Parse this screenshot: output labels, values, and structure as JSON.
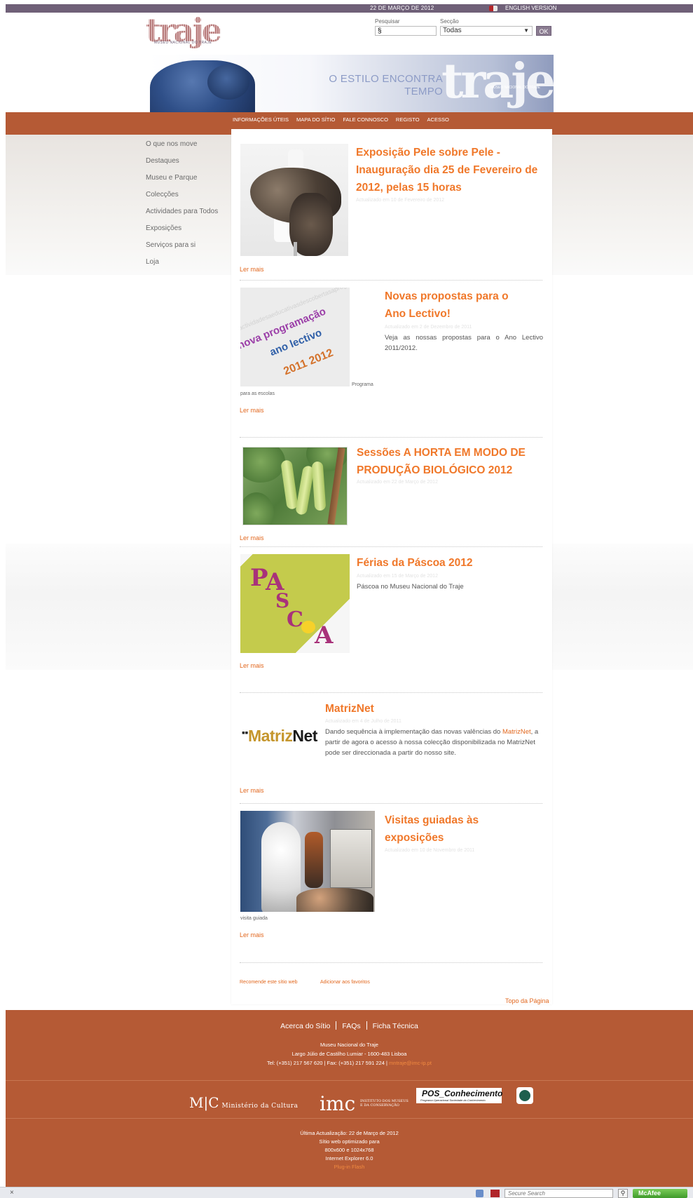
{
  "header": {
    "date": "22 DE MARÇO DE 2012",
    "english_link": "ENGLISH VERSION",
    "logo_text": "traje",
    "logo_subtitle": "MUSEU NACIONAL DO TRAJE",
    "search_label": "Pesquisar",
    "search_value": "§",
    "section_label": "Secção",
    "section_value": "Todas",
    "ok_label": "OK"
  },
  "banner": {
    "slogan_line1": "O ESTILO ENCONTRA",
    "slogan_line2": "TEMPO",
    "brand": "traje",
    "brand_sub": "MUSEU NACIONAL DO TRAJE"
  },
  "topnav": [
    "INFORMAÇÕES ÚTEIS",
    "MAPA DO SÍTIO",
    "FALE CONNOSCO",
    "REGISTO",
    "ACESSO"
  ],
  "sidebar": [
    "O que nos move",
    "Destaques",
    "Museu e Parque",
    "Colecções",
    "Actividades para Todos",
    "Exposições",
    "Serviços para si",
    "Loja"
  ],
  "articles": {
    "a1": {
      "title": "Exposição Pele sobre Pele - Inauguração dia 25 de Fevereiro de 2012, pelas 15 horas",
      "updated": "Actualizado em 10 de Fevereiro de 2012",
      "read_more": "Ler mais"
    },
    "a2": {
      "title": "Novas propostas para o Ano Lectivo!",
      "updated": "Actualizado em 2 de Dezembro de 2011",
      "description": "Veja as nossas propostas para o Ano Lectivo 2011/2012.",
      "caption_right": "Programa",
      "caption_below": "para as escolas",
      "read_more": "Ler mais",
      "image_words": [
        "nova programação",
        "ano lectivo",
        "2011 2012"
      ]
    },
    "a3": {
      "title": "Sessões A HORTA EM MODO DE PRODUÇÃO BIOLÓGICO 2012",
      "updated": "Actualizado em 22 de Março de 2012",
      "read_more": "Ler mais"
    },
    "a4": {
      "title": "Férias da Páscoa 2012",
      "updated": "Actualizado em 15 de Março de 2012",
      "description": "Páscoa no Museu Nacional do Traje",
      "read_more": "Ler mais",
      "image_letters": [
        "P",
        "A",
        "S",
        "C",
        "O",
        "A"
      ]
    },
    "a5": {
      "title": "MatrizNet",
      "updated": "Actualizado em 4 de Julho de 2011",
      "description_part1": "Dando sequência à implementação das novas valências do ",
      "description_link": "MatrizNet",
      "description_part2": ", a partir de agora o acesso à nossa colecção disponibilizada no MatrizNet pode ser direccionada a partir do nosso site.",
      "logo_prefix": "Matriz",
      "logo_suffix": "Net",
      "read_more": "Ler mais"
    },
    "a6": {
      "title": "Visitas guiadas às exposições",
      "updated": "Actualizado em 10 de Novembro de 2011",
      "caption": "visita guiada",
      "read_more": "Ler mais"
    }
  },
  "bottom_links": {
    "recommend": "Recomende este sítio web",
    "favorites": "Adicionar aos favoritos",
    "top": "Topo da Página"
  },
  "footer": {
    "nav": [
      "Acerca do Sítio",
      "FAQs",
      "Ficha Técnica"
    ],
    "museum": "Museu Nacional do Traje",
    "address": "Largo Júlio de Castilho Lumiar - 1600-483 Lisboa",
    "phone_fax": "Tel: (+351) 217 567 620 | Fax: (+351) 217 591 224 |",
    "email": "mntraje@imc-ip.pt",
    "logo_mc": "M|C",
    "logo_mc_text": "Ministério da Cultura",
    "logo_imc": "imc",
    "logo_imc_sub": "INSTITUTO DOS MUSEUS E DA CONSERVAÇÃO",
    "logo_pos": "POS_Conhecimento",
    "logo_pos_sub": "Programa Operacional Sociedade do Conhecimento",
    "last_update": "Última Actualização: 22 de Março de 2012",
    "optimized1": "Sítio web optimizado para",
    "optimized2": "800x600 e 1024x768",
    "optimized3": "Internet Explorer 6.0",
    "plugin": "Plug-in Flash"
  },
  "statusbar": {
    "close": "×",
    "search_placeholder": "Secure Search",
    "mcafee": "McAfee"
  },
  "colors": {
    "accent_orange": "#f0782a",
    "nav_band": "#b55a35",
    "top_bar": "#6f6078"
  }
}
